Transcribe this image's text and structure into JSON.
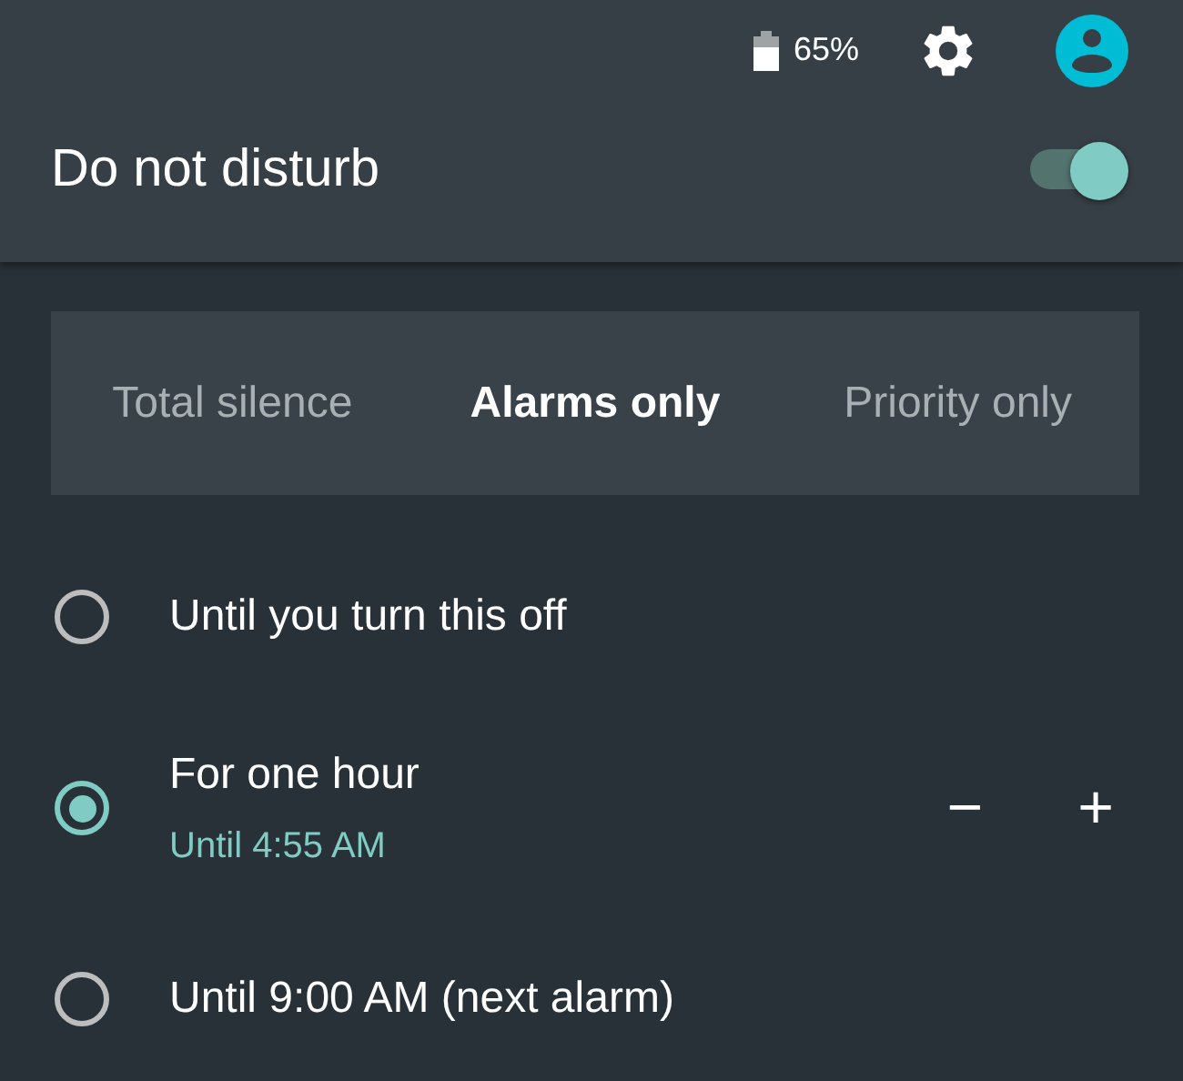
{
  "status_bar": {
    "battery": "65%"
  },
  "header": {
    "title": "Do not disturb",
    "on": true
  },
  "modes": [
    {
      "label": "Total silence",
      "selected": false
    },
    {
      "label": "Alarms only",
      "selected": true
    },
    {
      "label": "Priority only",
      "selected": false
    }
  ],
  "options": [
    {
      "label": "Until you turn this off",
      "selected": false
    },
    {
      "label": "For one hour",
      "sublabel": "Until 4:55 AM",
      "selected": true,
      "decrease": "−",
      "increase": "+"
    },
    {
      "label": "Until 9:00 AM (next alarm)",
      "selected": false
    }
  ]
}
